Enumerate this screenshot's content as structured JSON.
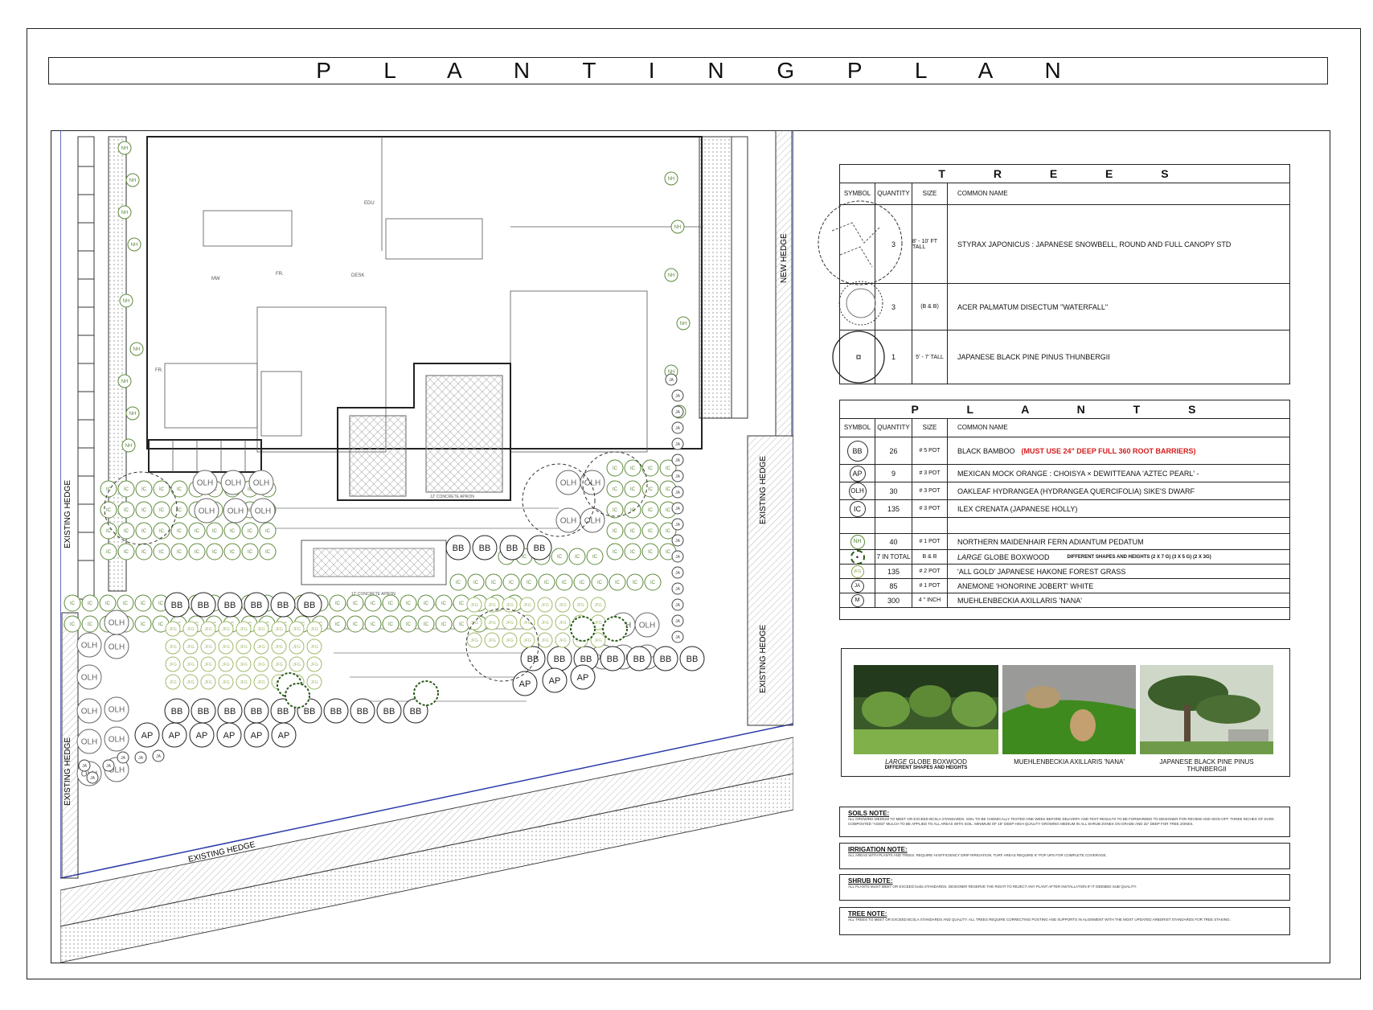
{
  "title": "P L A N T I N G   P L A N",
  "plan": {
    "labels": {
      "existing_hedge_left": "EXISTING HEDGE",
      "existing_hedge_left_lower": "EXISTING HEDGE",
      "existing_hedge_bottom": "EXISTING HEDGE",
      "existing_hedge_right_upper": "EXISTING HEDGE",
      "existing_hedge_right_lower": "EXISTING HEDGE",
      "new_hedge": "NEW HEDGE",
      "concrete_apron_1": "12' CONCRETE APRON",
      "concrete_apron_2": "12' CONCRETE APRON",
      "edu": "EDU",
      "mw": "MW",
      "fr": "FR.",
      "desk": "DESK",
      "fr2": "FR."
    },
    "tags": {
      "bb": "BB",
      "ap": "AP",
      "olh": "OLH",
      "ic": "IC",
      "nh": "NH",
      "jfg": "JFG",
      "ja": "JA"
    }
  },
  "trees": {
    "title": "T R E E S",
    "headers": {
      "symbol": "SYMBOL",
      "quantity": "QUANTITY",
      "size": "SIZE",
      "name": "COMMON NAME"
    },
    "rows": [
      {
        "quantity": "3",
        "size": "8' - 10' FT TALL",
        "name": "STYRAX JAPONICUS : JAPANESE SNOWBELL, ROUND AND FULL CANOPY STD"
      },
      {
        "quantity": "3",
        "size": "(B & B)",
        "name": "ACER PALMATUM DISECTUM \"WATERFALL\""
      },
      {
        "quantity": "1",
        "size": "5' - 7' TALL",
        "name": "JAPANESE BLACK PINE     PINUS THUNBERGII"
      }
    ]
  },
  "plants": {
    "title": "P L A N T S",
    "headers": {
      "symbol": "SYMBOL",
      "quantity": "QUANTITY",
      "size": "SIZE",
      "name": "COMMON NAME"
    },
    "rows": [
      {
        "symbol": "BB",
        "quantity": "26",
        "size": "# 5 POT",
        "name": "BLACK BAMBOO",
        "warning": "(MUST USE 24\" DEEP FULL 360 ROOT BARRIERS)"
      },
      {
        "symbol": "AP",
        "quantity": "9",
        "size": "# 3 POT",
        "name": "MEXICAN MOCK ORANGE : CHOISYA × DEWITTEANA 'AZTEC PEARL' -"
      },
      {
        "symbol": "OLH",
        "quantity": "30",
        "size": "# 3 POT",
        "name": "OAKLEAF HYDRANGEA (HYDRANGEA QUERCIFOLIA) SIKE'S DWARF"
      },
      {
        "symbol": "IC",
        "quantity": "135",
        "size": "# 3 POT",
        "name": "ILEX CRENATA (JAPANESE HOLLY)"
      },
      {
        "symbol": "",
        "quantity": "",
        "size": "",
        "name": ""
      },
      {
        "symbol": "NH",
        "quantity": "40",
        "size": "# 1 POT",
        "name": "NORTHERN MAIDENHAIR FERN     ADIANTUM PEDATUM"
      },
      {
        "symbol": "•",
        "quantity": "7 IN TOTAL",
        "size": "B & B",
        "name_italic": "LARGE",
        "name": "GLOBE BOXWOOD",
        "extra": "DIFFERENT SHAPES AND HEIGHTS    (2 X 7 G)    (3 X 5 G)    (2 X 3G)"
      },
      {
        "symbol": "JFG",
        "quantity": "135",
        "size": "# 2 POT",
        "name": "'ALL GOLD' JAPANESE HAKONE FOREST GRASS"
      },
      {
        "symbol": "JA",
        "quantity": "85",
        "size": "# 1 POT",
        "name": "ANEMONE 'HONORINE JOBERT' WHITE"
      },
      {
        "symbol": "M",
        "quantity": "300",
        "size": "4 \" INCH",
        "name": "MUEHLENBECKIA AXILLARIS 'NANA'"
      }
    ]
  },
  "photos": [
    {
      "caption_italic": "LARGE",
      "caption": "GLOBE BOXWOOD",
      "sub": "DIFFERENT SHAPES AND HEIGHTS"
    },
    {
      "caption": "MUEHLENBECKIA AXILLARIS 'NANA'"
    },
    {
      "caption": "JAPANESE BLACK PINE     PINUS THUNBERGII"
    }
  ],
  "notes": [
    {
      "heading": "SOILS NOTE:",
      "text": "ALL GROWING MEDIUM TO MEET OR EXCEED BCSLA STANDARDS. SOIL TO BE CHEMICALLY TESTED ONE WEEK BEFORE DELIVERY AND TEST RESULTS TO BE FORWARDED TO DESIGNER FOR REVIEW AND SIGN OFF. THREE INCHES OF DARK COMPOSTED \"AGED\" MULCH TO BE APPLIED TO ALL AREAS WITH SOIL. MINIMUM OF 18\" DEEP HIGH QUALITY GROWING MEDIUM IN ALL SHRUB ZONES ON GRADE AND 32\" DEEP FOR TREE ZONES."
    },
    {
      "heading": "IRRIGATION NOTE:",
      "text": "ALL AREAS WITH PLANTS AND TREES. REQUIRE HI EFFICIENCY DRIP IRRIGATION. TURF AREAS REQUIRE 6\" POP UPS FOR COMPLETE COVERAGE."
    },
    {
      "heading": "SHRUB NOTE:",
      "text": "ALL PLANTS MUST MEET OR EXCEED bcsla STANDARDS. DESIGNER RESERVE THE RIGHT TO REJECT ANY PLANT AFTER INSTALLATION IF IT DEEMED SUB QUALITY."
    },
    {
      "heading": "TREE NOTE:",
      "text": "ALL TREES TO MEET OR EXCEED BCSLA STANDARDS AND QUALITY. ALL TREES REQUIRE CORRECTING POSTING AND SUPPORTS IN ALIGNMENT WITH THE MOST UPDATED ARBORIST STANDARDS FOR TREE STAKING."
    }
  ],
  "colors": {
    "plant_green": "#5d8a3a",
    "light_green": "#9fba6a",
    "boundary_blue": "#2a3aa8",
    "warning_red": "#d41b1b"
  }
}
